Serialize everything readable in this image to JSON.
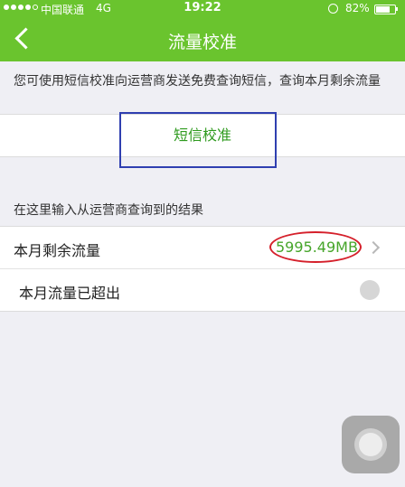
{
  "status_bar": {
    "carrier": "中国联通",
    "network": "4G",
    "time": "19:22",
    "battery": "82%",
    "battery_level": 0.82
  },
  "nav": {
    "title": "流量校准",
    "back_icon": "chevron-left"
  },
  "description": "您可使用短信校准向运营商发送免费查询短信，查询本月剩余流量",
  "sms_button_label": "短信校准",
  "section_label": "在这里输入从运营商查询到的结果",
  "rows": [
    {
      "label": "本月剩余流量",
      "value": "5995.49MB",
      "accessory": "chevron-right"
    },
    {
      "label": "本月流量已超出",
      "accessory": "toggle",
      "checked": false
    }
  ],
  "colors": {
    "nav_green": "#6ac42e",
    "accent_green": "#46a52a",
    "annotation_blue": "#2f3fb0",
    "annotation_red": "#d5202b"
  }
}
